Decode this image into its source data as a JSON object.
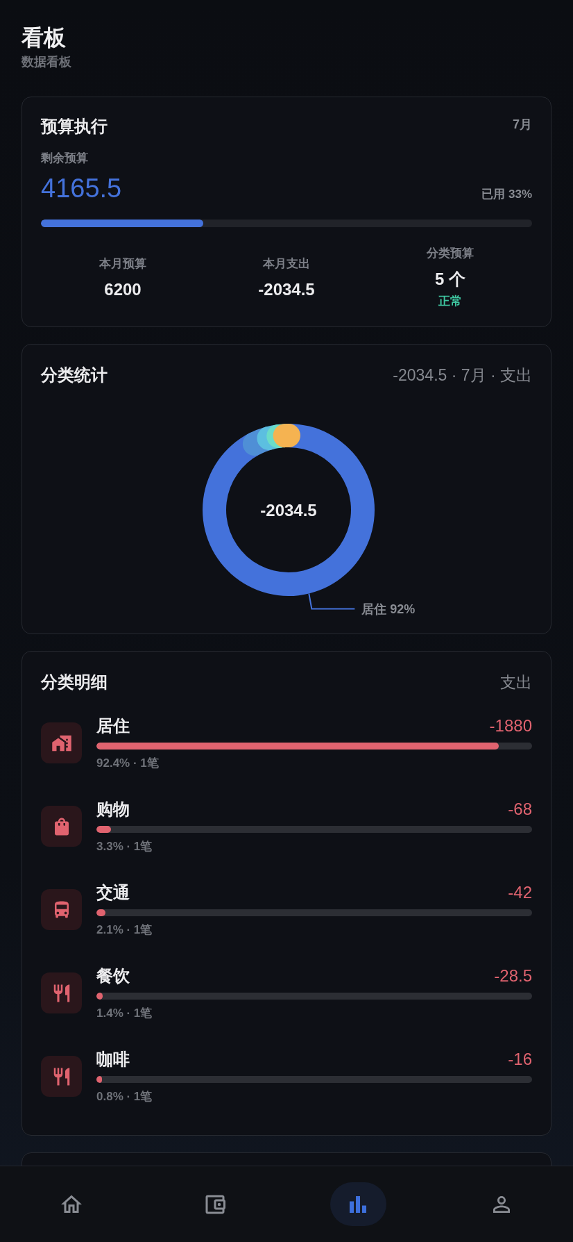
{
  "header": {
    "title": "看板",
    "subtitle": "数据看板"
  },
  "budget": {
    "title": "预算执行",
    "month": "7月",
    "remaining_label": "剩余预算",
    "remaining": "4165.5",
    "used": "已用 33%",
    "level": 0.33,
    "stats": [
      {
        "label": "本月预算",
        "value": "6200"
      },
      {
        "label": "本月支出",
        "value": "-2034.5"
      },
      {
        "label": "分类预算",
        "value": "5 个",
        "status": "正常"
      }
    ]
  },
  "category_stats": {
    "title": "分类统计",
    "summary": "-2034.5 · 7月 · 支出",
    "center_value": "-2034.5",
    "slice_label": "居住 92%"
  },
  "category_details": {
    "title": "分类明细",
    "type_label": "支出",
    "items": [
      {
        "name": "居住",
        "amount": "-1880",
        "level": 0.924,
        "meta": "92.4% · 1笔"
      },
      {
        "name": "购物",
        "amount": "-68",
        "level": 0.033,
        "meta": "3.3% · 1笔"
      },
      {
        "name": "交通",
        "amount": "-42",
        "level": 0.021,
        "meta": "2.1% · 1笔"
      },
      {
        "name": "餐饮",
        "amount": "-28.5",
        "level": 0.014,
        "meta": "1.4% · 1笔"
      },
      {
        "name": "咖啡",
        "amount": "-16",
        "level": 0.008,
        "meta": "0.8% · 1笔"
      }
    ]
  },
  "bottom_nav": {
    "items": [
      {
        "selected": false
      },
      {
        "selected": false
      },
      {
        "selected": true
      },
      {
        "selected": false
      }
    ]
  }
}
